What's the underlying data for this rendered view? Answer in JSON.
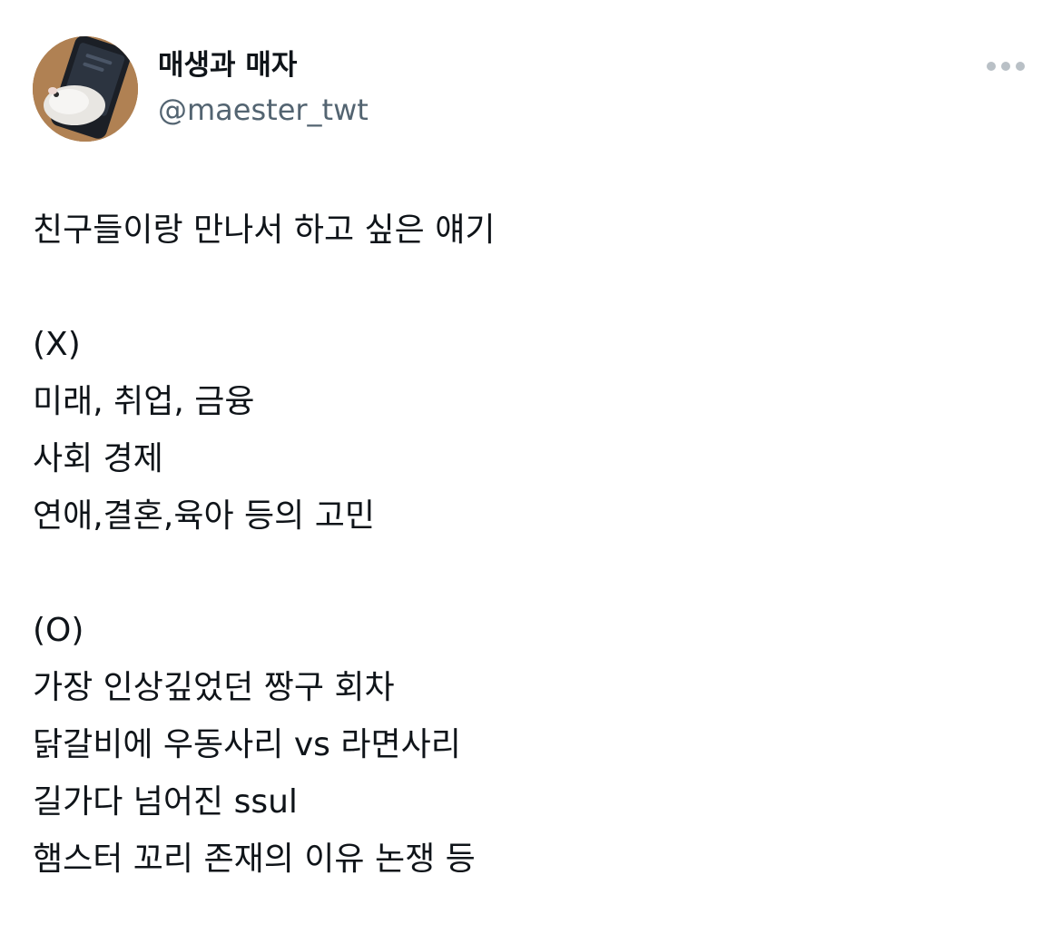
{
  "author": {
    "display_name": "매생과 매자",
    "handle": "@maester_twt",
    "avatar_icon": "hamster-phone-avatar"
  },
  "menu": {
    "more_icon": "more-horizontal-icon",
    "icon_color": "#b9c0c6"
  },
  "tweet": {
    "lines": [
      "친구들이랑 만나서 하고 싶은 얘기",
      "",
      "(X)",
      "미래, 취업, 금융",
      "사회 경제",
      "연애,결혼,육아 등의 고민",
      "",
      "(O)",
      "가장 인상깊었던 짱구 회차",
      "닭갈비에 우동사리 vs 라면사리",
      "길가다 넘어진 ssul",
      "햄스터 꼬리 존재의 이유 논쟁 등"
    ]
  },
  "colors": {
    "text_primary": "#0f1419",
    "text_secondary": "#536471"
  }
}
